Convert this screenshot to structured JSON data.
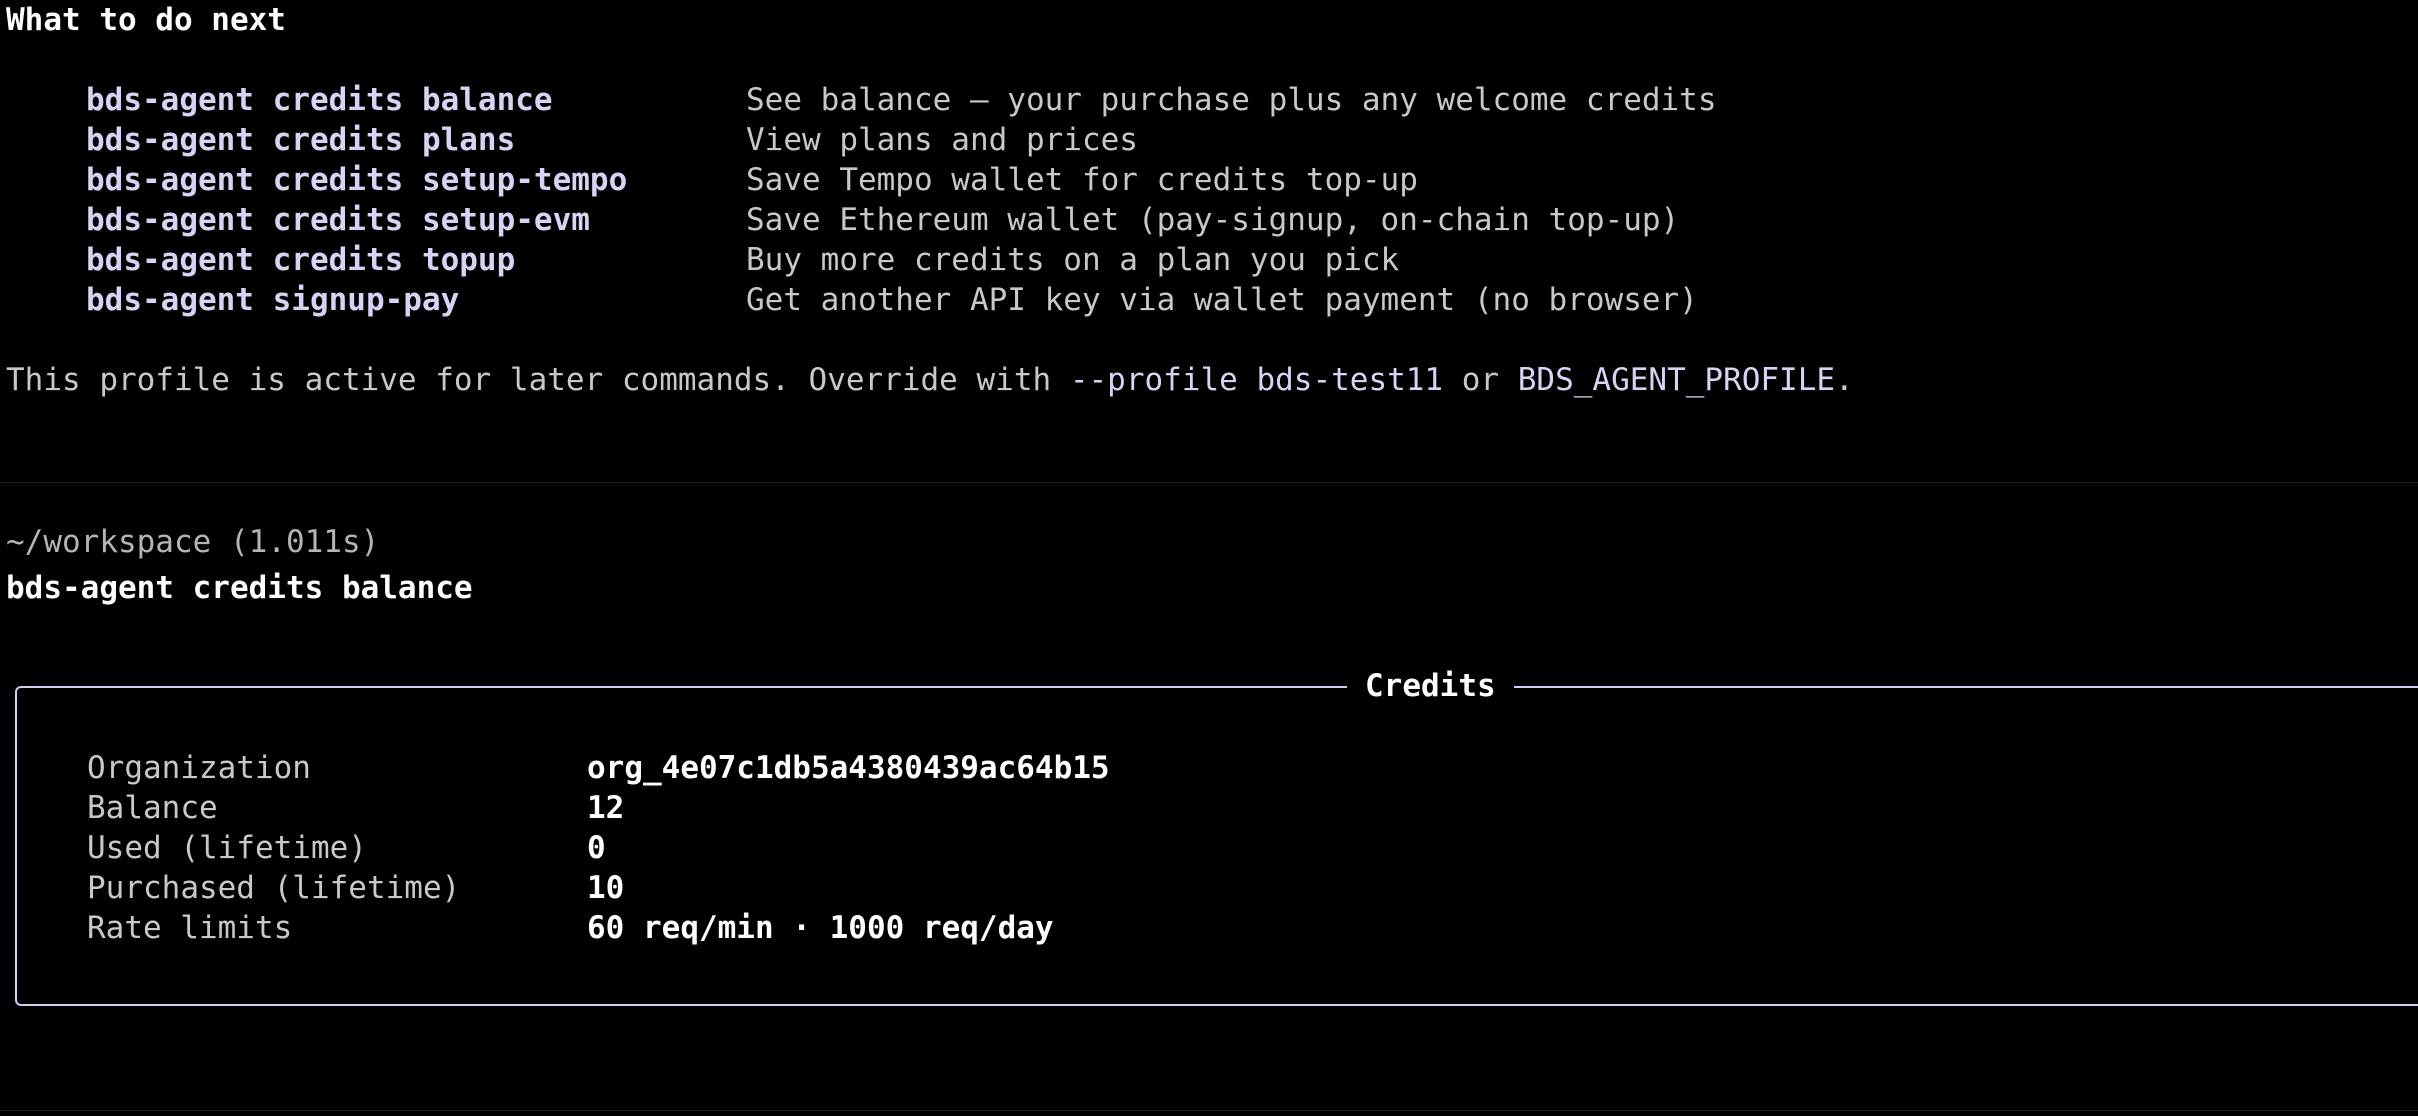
{
  "section_heading": "What to do next",
  "next_steps": [
    {
      "command": "bds-agent credits balance",
      "description": "See balance — your purchase plus any welcome credits"
    },
    {
      "command": "bds-agent credits plans",
      "description": "View plans and prices"
    },
    {
      "command": "bds-agent credits setup-tempo",
      "description": "Save Tempo wallet for credits top-up"
    },
    {
      "command": "bds-agent credits setup-evm",
      "description": "Save Ethereum wallet (pay-signup, on-chain top-up)"
    },
    {
      "command": "bds-agent credits topup",
      "description": "Buy more credits on a plan you pick"
    },
    {
      "command": "bds-agent signup-pay",
      "description": "Get another API key via wallet payment (no browser)"
    }
  ],
  "profile_note": {
    "prefix": "This profile is active for later commands. Override with ",
    "flag": "--profile bds-test11",
    "middle": " or ",
    "env_var": "BDS_AGENT_PROFILE",
    "suffix": "."
  },
  "prompt": {
    "path_and_time": "~/workspace (1.011s)",
    "command": "bds-agent credits balance"
  },
  "credits_panel": {
    "title": "Credits",
    "rows": [
      {
        "label": "Organization",
        "value": "org_4e07c1db5a4380439ac64b15"
      },
      {
        "label": "Balance",
        "value": "12"
      },
      {
        "label": "Used (lifetime)",
        "value": "0"
      },
      {
        "label": "Purchased (lifetime)",
        "value": "10"
      },
      {
        "label": "Rate limits",
        "value": "60 req/min · 1000 req/day"
      }
    ]
  },
  "colors": {
    "background": "#000000",
    "command_accent": "#d6d4f5",
    "panel_border": "#cfcdf0",
    "text": "#c8c8c8"
  }
}
